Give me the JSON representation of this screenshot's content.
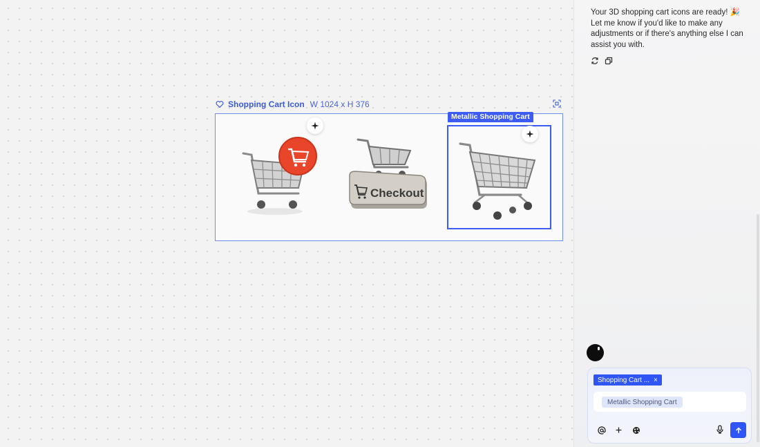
{
  "canvas": {
    "frame": {
      "name": "Shopping Cart Icon",
      "dimensions": "W 1024 x H 376",
      "selected_label": "Metallic Shopping Cart"
    },
    "items": [
      {
        "name": "cart-with-badge",
        "badge_color": "#e8452a"
      },
      {
        "name": "checkout-button",
        "text": "Checkout"
      },
      {
        "name": "metallic-cart"
      }
    ]
  },
  "chat": {
    "message": "Your 3D shopping cart icons are ready! 🎉 Let me know if you'd like to make any adjustments or if there's anything else I can assist you with.",
    "icons": [
      "refresh-icon",
      "copy-icon"
    ],
    "composer": {
      "chip_label": "Shopping Cart ...",
      "input_tag": "Metallic Shopping Cart",
      "tools": [
        "at-icon",
        "plus-icon",
        "style-icon",
        "mic-icon",
        "send-icon"
      ]
    }
  },
  "colors": {
    "accent": "#2f55f5",
    "frame_label": "#3b5bdb"
  }
}
